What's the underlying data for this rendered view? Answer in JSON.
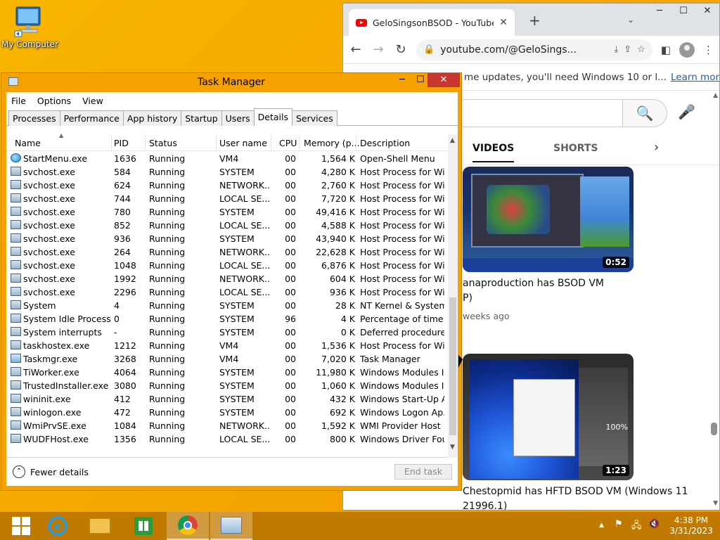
{
  "desktop": {
    "icon_label": "My Computer"
  },
  "chrome": {
    "tab_title": "GeloSingsonBSOD - YouTube",
    "tab_close": "✕",
    "new_tab": "+",
    "tab_dropdown": "⌄",
    "win_min": "─",
    "win_max": "☐",
    "win_close": "✕",
    "url": "youtube.com/@GeloSings...",
    "infobar_text": "me updates, you'll need Windows 10 or l...",
    "infobar_link": "Learn more",
    "infobar_close": "✕",
    "search_icon": "🔍",
    "mic_icon": "🎤",
    "tabs": [
      "VIDEOS",
      "SHORTS"
    ],
    "tabs_next": "›",
    "video1": {
      "duration": "0:52",
      "title": "anaproduction has BSOD VM",
      "title_line2": "P)",
      "meta": "weeks ago"
    },
    "video2": {
      "duration": "1:23",
      "percent_text": "100%",
      "title": "Chestopmid has HFTD BSOD VM (Windows 11",
      "title_line2": "21996.1)"
    }
  },
  "task_manager": {
    "title": "Task Manager",
    "controls": {
      "min": "─",
      "max": "☐",
      "close": "✕"
    },
    "menu": [
      "File",
      "Options",
      "View"
    ],
    "tabs": [
      "Processes",
      "Performance",
      "App history",
      "Startup",
      "Users",
      "Details",
      "Services"
    ],
    "active_tab": "Details",
    "columns": [
      "Name",
      "PID",
      "Status",
      "User name",
      "CPU",
      "Memory (p...",
      "Description"
    ],
    "rows": [
      {
        "name": "StartMenu.exe",
        "pid": "1636",
        "status": "Running",
        "user": "VM4",
        "cpu": "00",
        "mem": "1,564 K",
        "desc": "Open-Shell Menu",
        "icon": "globe"
      },
      {
        "name": "svchost.exe",
        "pid": "584",
        "status": "Running",
        "user": "SYSTEM",
        "cpu": "00",
        "mem": "4,280 K",
        "desc": "Host Process for Wi...",
        "icon": "sys"
      },
      {
        "name": "svchost.exe",
        "pid": "624",
        "status": "Running",
        "user": "NETWORK...",
        "cpu": "00",
        "mem": "2,760 K",
        "desc": "Host Process for Wi...",
        "icon": "sys"
      },
      {
        "name": "svchost.exe",
        "pid": "744",
        "status": "Running",
        "user": "LOCAL SE...",
        "cpu": "00",
        "mem": "7,720 K",
        "desc": "Host Process for Wi...",
        "icon": "sys"
      },
      {
        "name": "svchost.exe",
        "pid": "780",
        "status": "Running",
        "user": "SYSTEM",
        "cpu": "00",
        "mem": "49,416 K",
        "desc": "Host Process for Wi...",
        "icon": "sys"
      },
      {
        "name": "svchost.exe",
        "pid": "852",
        "status": "Running",
        "user": "LOCAL SE...",
        "cpu": "00",
        "mem": "4,588 K",
        "desc": "Host Process for Wi...",
        "icon": "sys"
      },
      {
        "name": "svchost.exe",
        "pid": "936",
        "status": "Running",
        "user": "SYSTEM",
        "cpu": "00",
        "mem": "43,940 K",
        "desc": "Host Process for Wi...",
        "icon": "sys"
      },
      {
        "name": "svchost.exe",
        "pid": "264",
        "status": "Running",
        "user": "NETWORK...",
        "cpu": "00",
        "mem": "22,628 K",
        "desc": "Host Process for Wi...",
        "icon": "sys"
      },
      {
        "name": "svchost.exe",
        "pid": "1048",
        "status": "Running",
        "user": "LOCAL SE...",
        "cpu": "00",
        "mem": "6,876 K",
        "desc": "Host Process for Wi...",
        "icon": "sys"
      },
      {
        "name": "svchost.exe",
        "pid": "1992",
        "status": "Running",
        "user": "NETWORK...",
        "cpu": "00",
        "mem": "604 K",
        "desc": "Host Process for Wi...",
        "icon": "sys"
      },
      {
        "name": "svchost.exe",
        "pid": "2296",
        "status": "Running",
        "user": "LOCAL SE...",
        "cpu": "00",
        "mem": "936 K",
        "desc": "Host Process for Wi...",
        "icon": "sys"
      },
      {
        "name": "System",
        "pid": "4",
        "status": "Running",
        "user": "SYSTEM",
        "cpu": "00",
        "mem": "28 K",
        "desc": "NT Kernel & System",
        "icon": "sys"
      },
      {
        "name": "System Idle Process",
        "pid": "0",
        "status": "Running",
        "user": "SYSTEM",
        "cpu": "96",
        "mem": "4 K",
        "desc": "Percentage of time t...",
        "icon": "sys"
      },
      {
        "name": "System interrupts",
        "pid": "-",
        "status": "Running",
        "user": "SYSTEM",
        "cpu": "00",
        "mem": "0 K",
        "desc": "Deferred procedure ...",
        "icon": "sys"
      },
      {
        "name": "taskhostex.exe",
        "pid": "1212",
        "status": "Running",
        "user": "VM4",
        "cpu": "00",
        "mem": "1,536 K",
        "desc": "Host Process for Wi...",
        "icon": "sys"
      },
      {
        "name": "Taskmgr.exe",
        "pid": "3268",
        "status": "Running",
        "user": "VM4",
        "cpu": "00",
        "mem": "7,020 K",
        "desc": "Task Manager",
        "icon": "tm"
      },
      {
        "name": "TiWorker.exe",
        "pid": "4064",
        "status": "Running",
        "user": "SYSTEM",
        "cpu": "00",
        "mem": "11,980 K",
        "desc": "Windows Modules I...",
        "icon": "sys"
      },
      {
        "name": "TrustedInstaller.exe",
        "pid": "3080",
        "status": "Running",
        "user": "SYSTEM",
        "cpu": "00",
        "mem": "1,060 K",
        "desc": "Windows Modules I...",
        "icon": "sys"
      },
      {
        "name": "wininit.exe",
        "pid": "412",
        "status": "Running",
        "user": "SYSTEM",
        "cpu": "00",
        "mem": "432 K",
        "desc": "Windows Start-Up A...",
        "icon": "sys"
      },
      {
        "name": "winlogon.exe",
        "pid": "472",
        "status": "Running",
        "user": "SYSTEM",
        "cpu": "00",
        "mem": "692 K",
        "desc": "Windows Logon Ap...",
        "icon": "sys"
      },
      {
        "name": "WmiPrvSE.exe",
        "pid": "1084",
        "status": "Running",
        "user": "NETWORK...",
        "cpu": "00",
        "mem": "1,592 K",
        "desc": "WMI Provider Host",
        "icon": "sys"
      },
      {
        "name": "WUDFHost.exe",
        "pid": "1356",
        "status": "Running",
        "user": "LOCAL SE...",
        "cpu": "00",
        "mem": "800 K",
        "desc": "Windows Driver Fou...",
        "icon": "sys"
      }
    ],
    "fewer_details": "Fewer details",
    "fewer_icon": "⌃",
    "end_task": "End task"
  },
  "taskbar": {
    "tray_icons": [
      "up-arrow-icon",
      "flag-icon",
      "network-icon",
      "speaker-muted-icon"
    ],
    "tray_glyphs": {
      "up": "▲",
      "flag": "⚑",
      "net": "🖧",
      "speaker": "🔇"
    },
    "time": "4:38 PM",
    "date": "3/31/2023"
  }
}
